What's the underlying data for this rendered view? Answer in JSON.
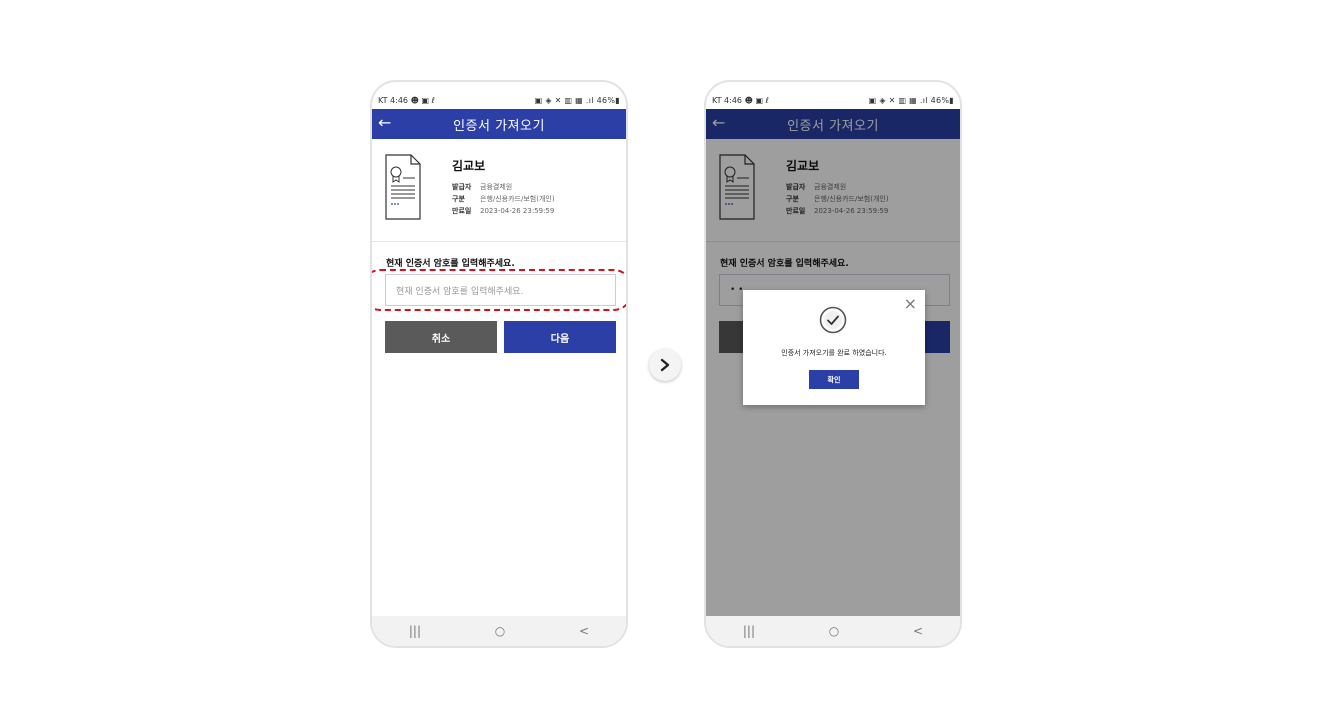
{
  "status_bar": {
    "left": "KT 4:46 ☻ ▣ ℓ",
    "right": "▣ ◈ ✕ ▥ ▦ .ıl 46%▮"
  },
  "app_bar": {
    "title": "인증서 가져오기",
    "back": "←"
  },
  "certificate": {
    "name": "김교보",
    "issuer_label": "발급자",
    "issuer_value": "금융결제원",
    "type_label": "구분",
    "type_value": "은행/신용카드/보험(개인)",
    "expiry_label": "만료일",
    "expiry_value": "2023-04-26 23:59:59"
  },
  "password": {
    "label": "현재 인증서 암호를 입력해주세요.",
    "placeholder": "현재 인증서 암호를 입력해주세요.",
    "masked_value": "• •"
  },
  "buttons": {
    "cancel": "취소",
    "next": "다음"
  },
  "nav": {
    "recents": "|||",
    "home": "○",
    "back": "<"
  },
  "dialog": {
    "message": "인증서 가져오기를 완료 하였습니다.",
    "ok": "확인",
    "close": "×"
  },
  "arrow": "›",
  "colors": {
    "primary": "#2b3fa6",
    "cancel": "#5a5a5a",
    "highlight": "#d0121b"
  }
}
